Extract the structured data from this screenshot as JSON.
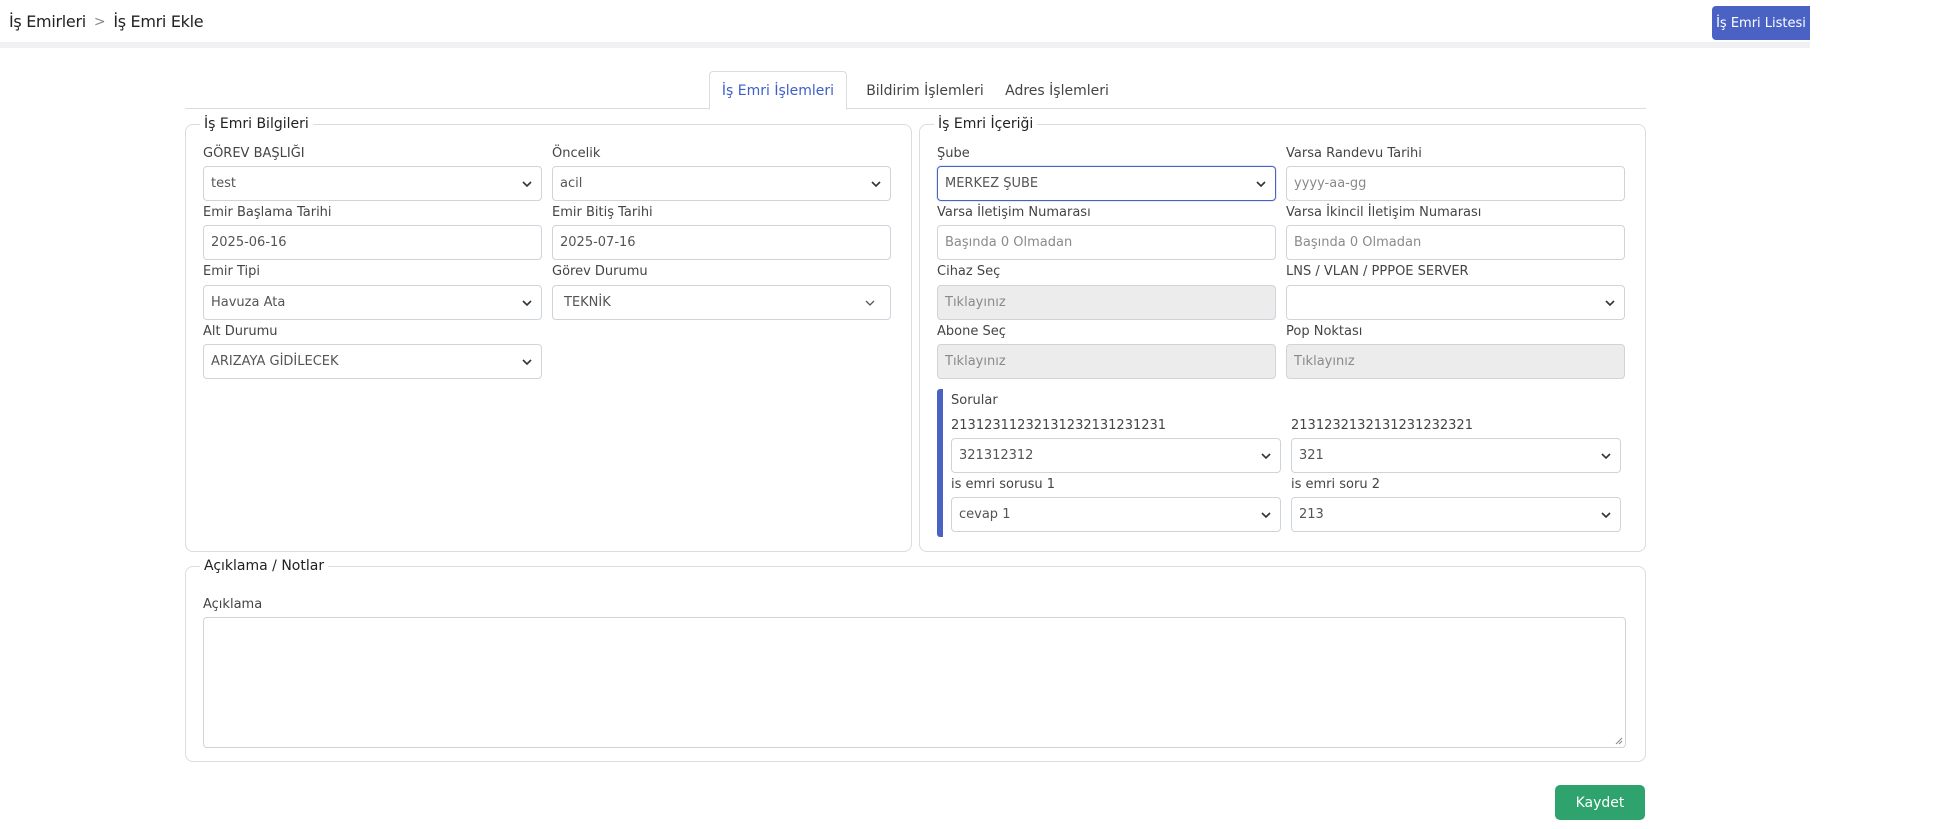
{
  "breadcrumb": {
    "parent": "İş Emirleri",
    "separator": ">",
    "current": "İş Emri Ekle"
  },
  "header": {
    "list_button": "İş Emri Listesi"
  },
  "tabs": [
    {
      "label": "İş Emri İşlemleri",
      "active": true
    },
    {
      "label": "Bildirim İşlemleri",
      "active": false
    },
    {
      "label": "Adres İşlemleri",
      "active": false
    }
  ],
  "info_section": {
    "legend": "İş Emri Bilgileri",
    "gorev_basligi": {
      "label": "GÖREV BAŞLIĞI",
      "value": "test"
    },
    "oncelik": {
      "label": "Öncelik",
      "value": "acil"
    },
    "baslama": {
      "label": "Emir Başlama Tarihi",
      "value": "2025-06-16"
    },
    "bitis": {
      "label": "Emir Bitiş Tarihi",
      "value": "2025-07-16"
    },
    "emir_tipi": {
      "label": "Emir Tipi",
      "value": "Havuza Ata"
    },
    "gorev_durumu": {
      "label": "Görev Durumu",
      "value": "TEKNİK"
    },
    "alt_durumu": {
      "label": "Alt Durumu",
      "value": "ARIZAYA GİDİLECEK"
    }
  },
  "content_section": {
    "legend": "İş Emri İçeriği",
    "sube": {
      "label": "Şube",
      "value": "MERKEZ ŞUBE"
    },
    "randevu": {
      "label": "Varsa Randevu Tarihi",
      "placeholder": "yyyy-aa-gg"
    },
    "iletisim": {
      "label": "Varsa İletişim Numarası",
      "placeholder": "Başında 0 Olmadan"
    },
    "ikincil": {
      "label": "Varsa İkincil İletişim Numarası",
      "placeholder": "Başında 0 Olmadan"
    },
    "cihaz": {
      "label": "Cihaz Seç",
      "placeholder": "Tıklayınız"
    },
    "lns": {
      "label": "LNS / VLAN / PPPOE SERVER",
      "value": ""
    },
    "abone": {
      "label": "Abone Seç",
      "placeholder": "Tıklayınız"
    },
    "pop": {
      "label": "Pop Noktası",
      "placeholder": "Tıklayınız"
    },
    "sorular": {
      "title": "Sorular",
      "q1": {
        "label": "21312311232131232131231231",
        "value": "321312312"
      },
      "q2": {
        "label": "2131232132131231232321",
        "value": "321"
      },
      "q3": {
        "label": "is emri sorusu 1",
        "value": "cevap 1"
      },
      "q4": {
        "label": "is emri soru 2",
        "value": "213"
      }
    }
  },
  "notes_section": {
    "legend": "Açıklama / Notlar",
    "aciklama_label": "Açıklama",
    "aciklama_value": ""
  },
  "save_button": "Kaydet",
  "colors": {
    "primary": "#4a62c4",
    "success": "#2ea36d"
  }
}
